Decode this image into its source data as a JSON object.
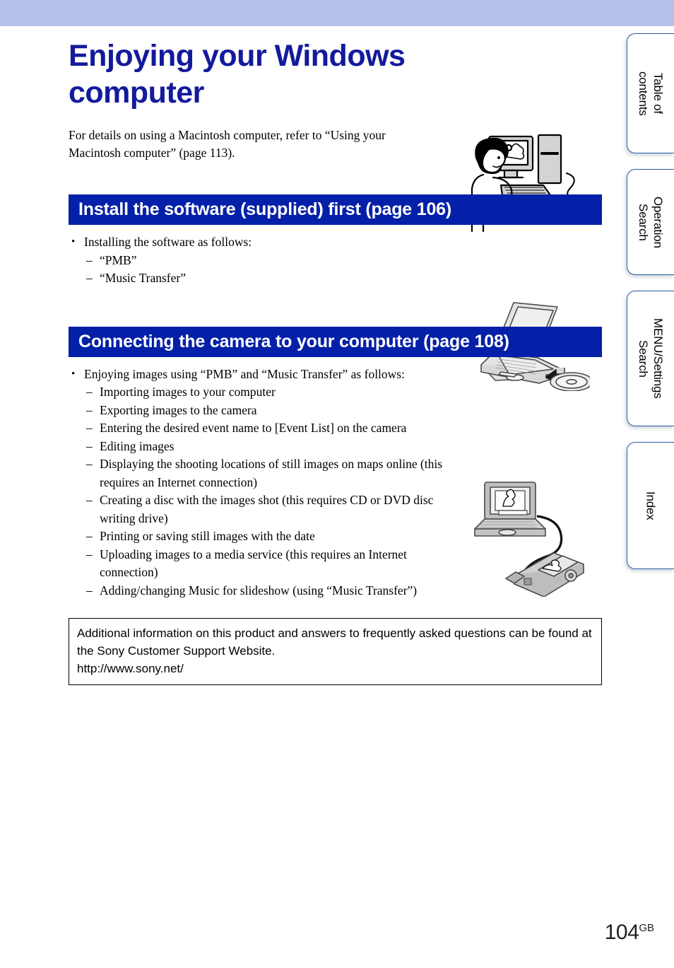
{
  "page": {
    "title": "Enjoying your Windows computer",
    "intro": "For details on using a Macintosh computer, refer to “Using your Macintosh computer” (page 113).",
    "number": "104",
    "number_suffix": "GB",
    "band_color": "#b4c2ea",
    "title_color": "#141a9c",
    "section_bar_color": "#0520a8"
  },
  "sections": [
    {
      "heading": "Install the software (supplied) first (page 106)",
      "bullets": [
        {
          "text": "Installing the software as follows:",
          "sub": [
            "“PMB”",
            "“Music Transfer”"
          ]
        }
      ],
      "illustration": "laptop-with-cd-icon"
    },
    {
      "heading": "Connecting the camera to your computer (page 108)",
      "bullets": [
        {
          "text": "Enjoying images using “PMB” and “Music Transfer” as follows:",
          "sub": [
            "Importing images to your computer",
            "Exporting images to the camera",
            "Entering the desired event name to [Event List] on the camera",
            "Editing images",
            "Displaying the shooting locations of still images on maps online (this requires an Internet connection)",
            "Creating a disc with the images shot (this requires CD or DVD disc writing drive)",
            "Printing or saving still images with the date",
            "Uploading images to a media service (this requires an Internet connection)",
            "Adding/changing Music for slideshow (using “Music Transfer”)"
          ]
        }
      ],
      "illustration": "laptop-camera-usb-icon"
    }
  ],
  "info_box": {
    "line1": "Additional information on this product and answers to frequently asked questions can be found at the Sony Customer Support Website.",
    "line2": "http://www.sony.net/"
  },
  "side_tabs": [
    {
      "label": "Table of\ncontents"
    },
    {
      "label": "Operation\nSearch"
    },
    {
      "label": "MENU/Settings\nSearch"
    },
    {
      "label": "Index"
    }
  ],
  "illustrations": {
    "person": "person-at-desktop-computer-with-camera-illustration",
    "laptop_cd": "laptop-inserting-cd-illustration",
    "laptop_camera": "laptop-connected-to-camera-illustration"
  }
}
